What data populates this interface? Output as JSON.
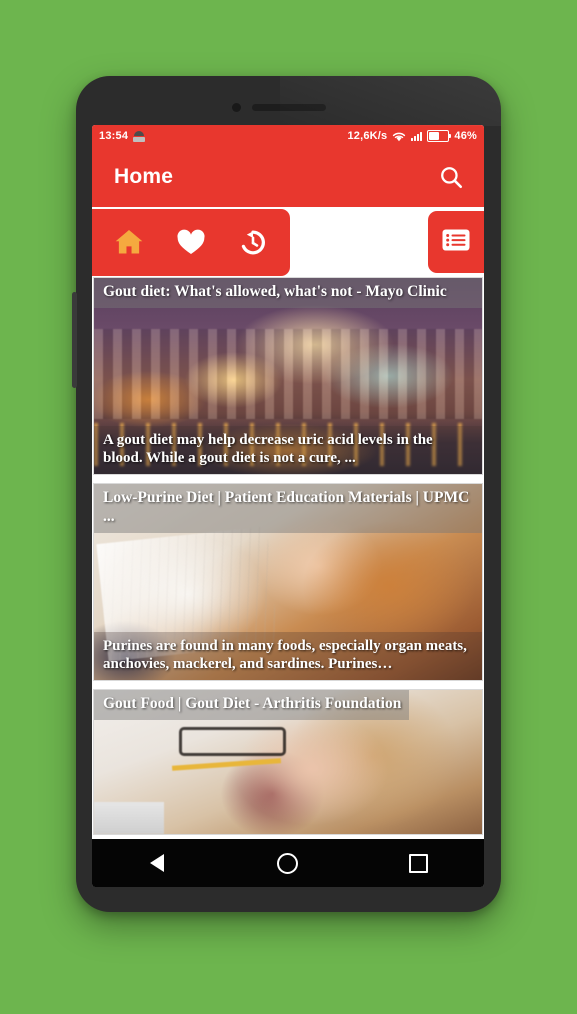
{
  "theme": {
    "background": "#6db54e",
    "accent_red": "#e8372e",
    "accent_orange": "#f5a93f",
    "phone_body": "#2c2c2c"
  },
  "statusbar": {
    "time": "13:54",
    "robot_icon": "android-robot-icon",
    "net_speed": "12,6K/s",
    "wifi_icon": "wifi-icon",
    "signal_icon": "signal-bars-icon",
    "battery_icon": "battery-icon",
    "battery_level": "46%"
  },
  "appbar": {
    "title": "Home",
    "search_icon": "search-icon"
  },
  "toolbar": {
    "tabs": [
      {
        "name": "home",
        "icon": "home-icon",
        "label": "Home",
        "active": true
      },
      {
        "name": "favorites",
        "icon": "heart-icon",
        "label": "Favorites",
        "active": false
      },
      {
        "name": "history",
        "icon": "history-icon",
        "label": "History",
        "active": false
      }
    ],
    "menu": {
      "name": "list",
      "icon": "list-icon",
      "label": "List"
    }
  },
  "cards": [
    {
      "title": "Gout diet: What's allowed, what's not - Mayo Clinic",
      "description": "A gout diet may help decrease uric acid levels in the blood. While a gout diet is not a cure, ...",
      "image": "night-cityscape-photo"
    },
    {
      "title": "Low-Purine Diet | Patient Education Materials | UPMC ...",
      "description": "Purines are found in many foods, especially organ meats, anchovies, mackerel, and sardines. Purines…",
      "image": "girl-studying-with-books-photo"
    },
    {
      "title": "Gout Food | Gout Diet - Arthritis Foundation",
      "description": "",
      "image": "woman-biting-pencil-photo"
    }
  ],
  "navbar": {
    "back_label": "Back",
    "home_label": "Home",
    "recents_label": "Recents"
  }
}
